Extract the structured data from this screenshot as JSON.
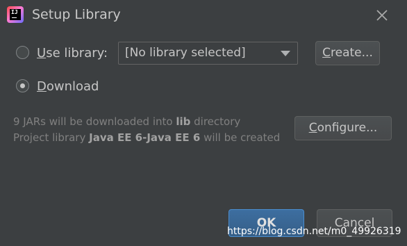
{
  "window": {
    "title": "Setup Library",
    "icon": "intellij-idea-icon",
    "close_icon": "close-icon"
  },
  "use_library": {
    "label_mnemonic": "U",
    "label_rest": "se library:",
    "selected": false,
    "combo_value": "[No library selected]",
    "create_mnemonic": "C",
    "create_rest": "reate..."
  },
  "download": {
    "label_mnemonic": "D",
    "label_rest": "ownload",
    "selected": true
  },
  "info": {
    "line1_prefix": "9 JARs will be downloaded into ",
    "line1_bold": "lib",
    "line1_suffix": " directory",
    "line2_prefix": "Project library ",
    "line2_bold": "Java EE 6-Java EE 6",
    "line2_suffix": " will be created"
  },
  "configure": {
    "mnemonic": "C",
    "rest": "onfigure..."
  },
  "footer": {
    "ok_label": "OK",
    "cancel_label": "Cancel"
  },
  "watermark": "https://blog.csdn.net/m0_49926319",
  "colors": {
    "background": "#3c3f41",
    "ok_button": "#365f88",
    "ok_border": "#4b8ecf"
  }
}
